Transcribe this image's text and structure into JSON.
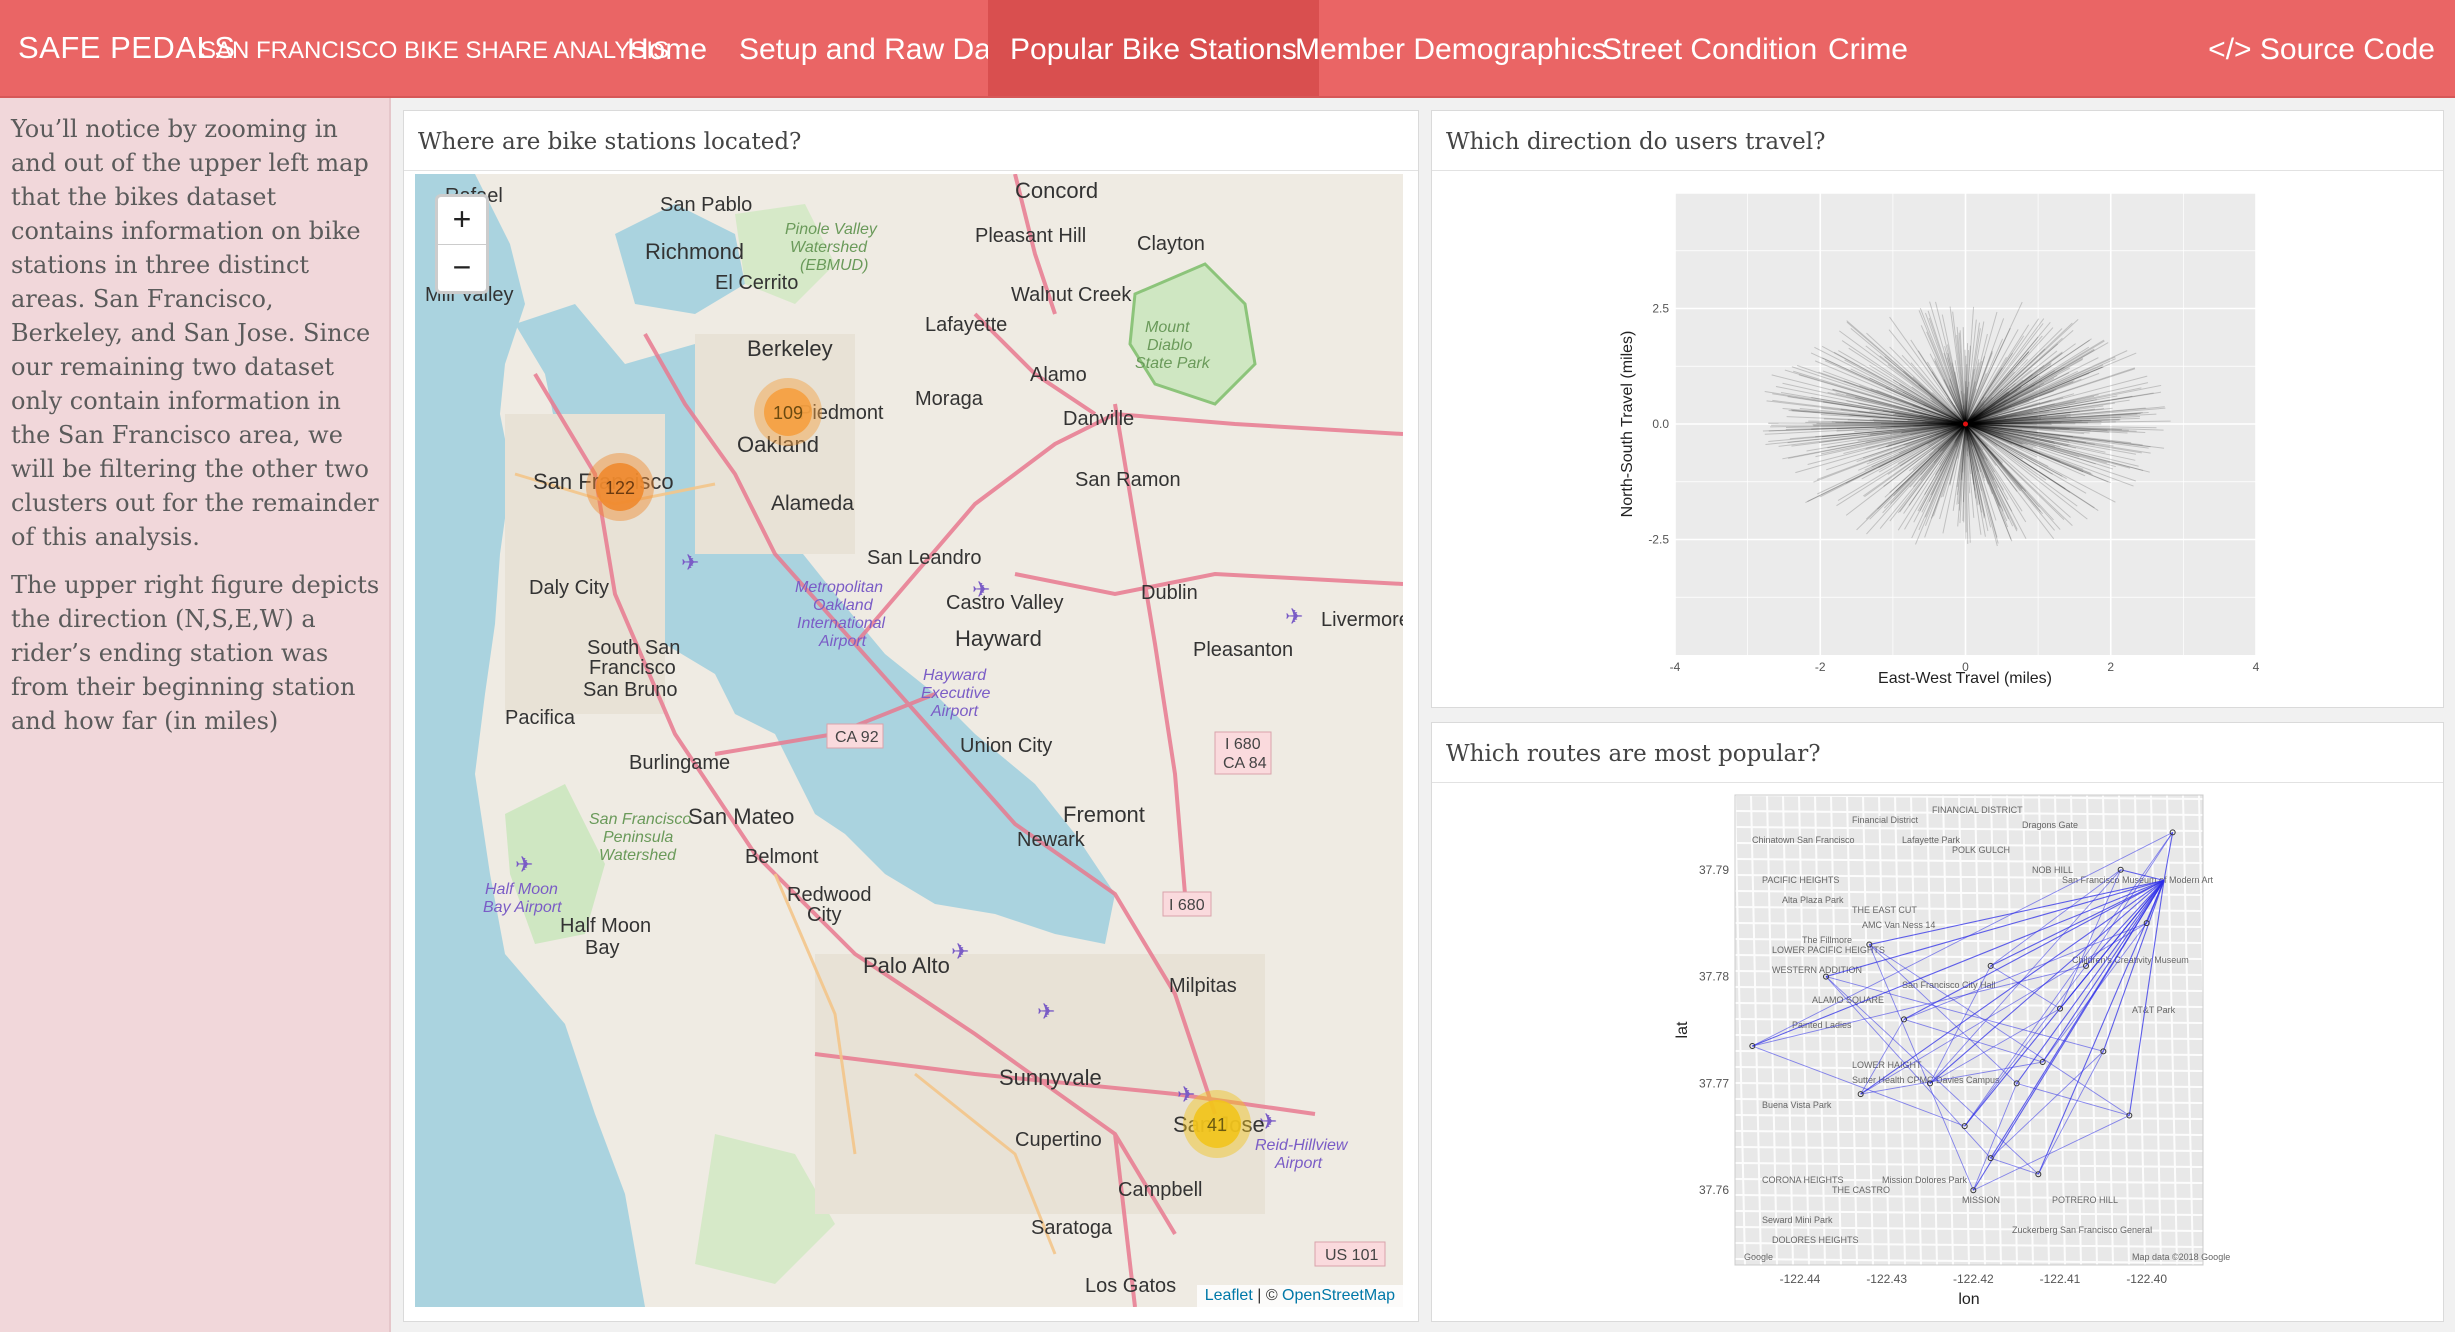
{
  "brand": "SAFE PEDALS",
  "subtitle": "SAN FRANCISCO BIKE SHARE ANALYSIS",
  "nav": [
    "Home",
    "Setup and Raw Data",
    "Popular Bike Stations",
    "Member Demographics",
    "Street Condition",
    "Crime"
  ],
  "active_tab": "Popular Bike Stations",
  "source_code": "</> Source Code",
  "sidebar": {
    "p1": "You’ll notice by zooming in and out of the upper left map that the bikes dataset contains information on bike stations in three distinct areas. San Francisco, Berkeley, and San Jose. Since our remaining two dataset only contain information in the San Francisco area, we will be filtering the other two clusters out for the remainder of this analysis.",
    "p2": "The upper right figure depicts the direction (N,S,E,W) a rider’s ending station was from their beginning station and how far (in miles)"
  },
  "map_panel": {
    "title": "Where are bike stations located?",
    "zoom_in": "+",
    "zoom_out": "−",
    "attribution": {
      "leaflet": "Leaflet",
      "sep": " | © ",
      "osm": "OpenStreetMap"
    },
    "clusters": [
      {
        "label": "109",
        "color": "#f5a040"
      },
      {
        "label": "122",
        "color": "#f08a2e"
      },
      {
        "label": "41",
        "color": "#f2c41c"
      }
    ],
    "places": [
      "San Pablo",
      "Richmond",
      "El Cerrito",
      "Berkeley",
      "Oakland",
      "Alameda",
      "San Francisco",
      "Daly City",
      "South San Francisco",
      "San Bruno",
      "Pacifica",
      "Burlingame",
      "San Mateo",
      "Belmont",
      "Redwood City",
      "Half Moon Bay",
      "Palo Alto",
      "Sunnyvale",
      "Cupertino",
      "Campbell",
      "Saratoga",
      "Los Gatos",
      "San Jose",
      "Milpitas",
      "Fremont",
      "Newark",
      "Union City",
      "Hayward",
      "San Leandro",
      "Castro Valley",
      "Dublin",
      "Pleasanton",
      "Livermore",
      "San Ramon",
      "Danville",
      "Alamo",
      "Moraga",
      "Lafayette",
      "Walnut Creek",
      "Concord",
      "Pleasant Hill",
      "Clayton",
      "Mill Valley",
      "Piedmont",
      "Rafael",
      "Mount Diablo State Park",
      "Pinole Valley Watershed (EBMUD)",
      "Metropolitan Oakland International Airport",
      "Hayward Executive Airport",
      "Half Moon Bay Airport",
      "San Francisco Peninsula Watershed",
      "Reid-Hillview Airport"
    ],
    "shields": [
      "CA 92",
      "I 680 CA 84",
      "I 680",
      "US 101"
    ]
  },
  "direction_panel": {
    "title": "Which direction do users travel?",
    "chart_data": {
      "type": "line",
      "title": "",
      "xlabel": "East-West Travel (miles)",
      "ylabel": "North-South Travel (miles)",
      "xlim": [
        -4,
        4
      ],
      "ylim": [
        -5,
        5
      ],
      "xticks": [
        -4,
        -2,
        0,
        2,
        4
      ],
      "yticks": [
        -2.5,
        0.0,
        2.5
      ],
      "ytick_labels": [
        "-2.5",
        "0.0",
        "2.5"
      ],
      "xtick_labels": [
        "-4",
        "-2",
        "0",
        "2",
        "4"
      ],
      "description_series": "radial segments from origin (0,0), dense within ~3 miles",
      "origin_marker": {
        "x": 0,
        "y": 0,
        "color": "#e01010"
      },
      "grid": true
    }
  },
  "routes_panel": {
    "title": "Which routes are most popular?",
    "chart_data": {
      "type": "line",
      "title": "",
      "xlabel": "lon",
      "ylabel": "lat",
      "xticks": [
        -122.44,
        -122.43,
        -122.42,
        -122.41,
        -122.4
      ],
      "xtick_labels": [
        "-122.44",
        "-122.43",
        "-122.42",
        "-122.41",
        "-122.40"
      ],
      "yticks": [
        37.76,
        37.77,
        37.78,
        37.79
      ],
      "ytick_labels": [
        "37.76",
        "37.77",
        "37.78",
        "37.79"
      ],
      "xlim": [
        -122.4475,
        -122.3935
      ],
      "ylim": [
        37.753,
        37.797
      ],
      "route_color": "#2d2de8",
      "hub": {
        "lon": -122.398,
        "lat": 37.789
      },
      "stations": [
        {
          "lon": -122.4455,
          "lat": 37.7735
        },
        {
          "lon": -122.437,
          "lat": 37.78
        },
        {
          "lon": -122.432,
          "lat": 37.783
        },
        {
          "lon": -122.428,
          "lat": 37.776
        },
        {
          "lon": -122.425,
          "lat": 37.77
        },
        {
          "lon": -122.421,
          "lat": 37.766
        },
        {
          "lon": -122.418,
          "lat": 37.763
        },
        {
          "lon": -122.415,
          "lat": 37.77
        },
        {
          "lon": -122.412,
          "lat": 37.772
        },
        {
          "lon": -122.41,
          "lat": 37.777
        },
        {
          "lon": -122.407,
          "lat": 37.781
        },
        {
          "lon": -122.405,
          "lat": 37.773
        },
        {
          "lon": -122.402,
          "lat": 37.767
        },
        {
          "lon": -122.4,
          "lat": 37.785
        },
        {
          "lon": -122.403,
          "lat": 37.79
        },
        {
          "lon": -122.397,
          "lat": 37.7935
        },
        {
          "lon": -122.4125,
          "lat": 37.7615
        },
        {
          "lon": -122.42,
          "lat": 37.76
        },
        {
          "lon": -122.433,
          "lat": 37.769
        },
        {
          "lon": -122.418,
          "lat": 37.781
        }
      ],
      "map_labels": [
        "Chinatown San Francisco",
        "Financial District",
        "FINANCIAL DISTRICT",
        "PACIFIC HEIGHTS",
        "Alta Plaza Park",
        "Lafayette Park",
        "POLK GULCH",
        "Dragons Gate",
        "NOB HILL",
        "THE EAST CUT",
        "LOWER PACIFIC HEIGHTS",
        "San Francisco Museum of Modern Art",
        "AMC Van Ness 14",
        "The Fillmore",
        "WESTERN ADDITION",
        "ALAMO SQUARE",
        "Painted Ladies",
        "San Francisco City Hall",
        "LOWER HAIGHT",
        "Sutter Health CPMC Davies Campus",
        "Buena Vista Park",
        "CORONA HEIGHTS",
        "THE CASTRO",
        "Mission Dolores Park",
        "Seward Mini Park",
        "DOLORES HEIGHTS",
        "MISSION",
        "POTRERO HILL",
        "Zuckerberg San Francisco General",
        "Children's Creativity Museum",
        "AT&T Park",
        "Google",
        "Map data ©2018 Google"
      ]
    }
  }
}
